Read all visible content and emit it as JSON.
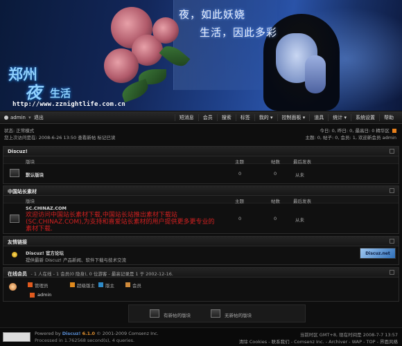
{
  "banner": {
    "poem_line1": "夜，如此妖娆",
    "poem_line2": "生活，因此多彩",
    "title_zhengzhou": "郑州",
    "title_ye": "夜",
    "title_life": "生活",
    "url": "http://www.zznightlife.com.cn"
  },
  "nav": {
    "user": "admin",
    "logout": "退出",
    "items": [
      "短消息",
      "会员",
      "搜索",
      "标签",
      "我的",
      "控制面板",
      "道具",
      "统计",
      "系统设置",
      "帮助"
    ]
  },
  "status": {
    "mode": "状态: 正常模式",
    "last_visit": "您上次访问是在: 2008-6-26 13:50 查看新帖  标记已读",
    "today": "今日: 0, 昨日: 0, 最高日: 0",
    "digest": "精华区",
    "stats": "主题: 0, 帖子: 0, 会员: 1, 欢迎新会员 admin"
  },
  "sections": {
    "discuz": {
      "title": "Discuz!",
      "col_forum": "版块",
      "col_topics": "主题",
      "col_posts": "帖数",
      "col_last": "最后发表",
      "rows": [
        {
          "name": "默认版块",
          "topics": "0",
          "posts": "0",
          "last": "从未"
        }
      ]
    },
    "china": {
      "title": "中国站长素材",
      "col_forum": "版块",
      "col_topics": "主题",
      "col_posts": "帖数",
      "col_last": "最后发表",
      "rows": [
        {
          "name": "SC.CHINAZ.COM",
          "desc": "欢迎访问中国站长素材下载,中国站长站推出素材下载站(SC.CHINAZ.COM),为支持和喜爱站长素材的用户提供更多更专业的素材下载.",
          "topics": "0",
          "posts": "0",
          "last": "从未"
        }
      ]
    },
    "links": {
      "title": "友情链接",
      "name": "Discuz! 官方论坛",
      "desc": "提供最新 Discuz! 产品新闻、软件下载与技术交流",
      "badge": "Discuz.net"
    },
    "online": {
      "title": "在线会员",
      "summary": "- 1 人在线 - 1 会员(0 隐身), 0 位游客 - 最高记录是 1 于 2002-12-16.",
      "roles": [
        "管理员",
        "超级版主",
        "版主",
        "会员"
      ],
      "user": "admin"
    }
  },
  "legend": {
    "new": "有新帖的版块",
    "nonew": "无新帖的版块"
  },
  "footer": {
    "powered": "Powered by",
    "discuz": "Discuz!",
    "version": "6.1.0",
    "copyright": "© 2001-2009 Comsenz Inc.",
    "processed": "Processed in 1.762568 second(s), 4 queries.",
    "timezone": "当前时区  GMT+8, 现在时间是  2008-7-7 13:57",
    "links": "清除 Cookies - 联系我们 - Comsenz Inc. - Archiver - WAP - TOP - 界面风格"
  }
}
